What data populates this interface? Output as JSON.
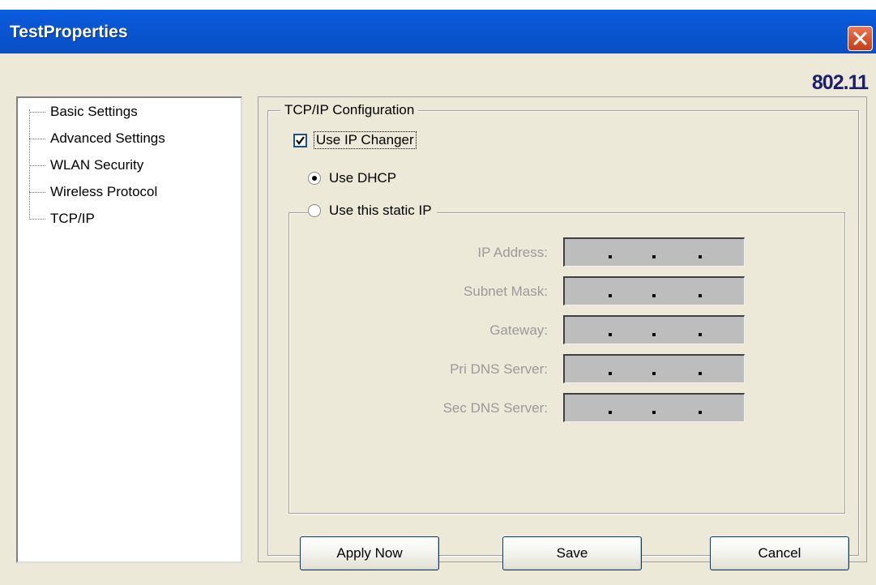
{
  "window": {
    "title": "TestProperties",
    "brand": "802.11",
    "close_label": "Close"
  },
  "tree": {
    "items": [
      {
        "label": "Basic Settings"
      },
      {
        "label": "Advanced Settings"
      },
      {
        "label": "WLAN Security"
      },
      {
        "label": "Wireless Protocol"
      },
      {
        "label": "TCP/IP"
      }
    ]
  },
  "tcpip": {
    "group_title": "TCP/IP Configuration",
    "use_ip_changer_label": "Use IP Changer",
    "use_ip_changer_checked": true,
    "use_dhcp_label": "Use DHCP",
    "use_dhcp_selected": true,
    "use_static_label": "Use this static IP",
    "use_static_selected": false,
    "fields": [
      {
        "label": "IP Address:",
        "value": ". . ."
      },
      {
        "label": "Subnet Mask:",
        "value": ". . ."
      },
      {
        "label": "Gateway:",
        "value": ". . ."
      },
      {
        "label": "Pri DNS Server:",
        "value": ". . ."
      },
      {
        "label": "Sec DNS Server:",
        "value": ". . ."
      }
    ]
  },
  "buttons": {
    "apply": "Apply Now",
    "save": "Save",
    "cancel": "Cancel"
  },
  "colors": {
    "titlebar": "#0854cf",
    "dialog_bg": "#ece9d8",
    "brand": "#1c1e6e",
    "disabled_text": "#9a9a9a",
    "disabled_field": "#bdbdbd"
  }
}
